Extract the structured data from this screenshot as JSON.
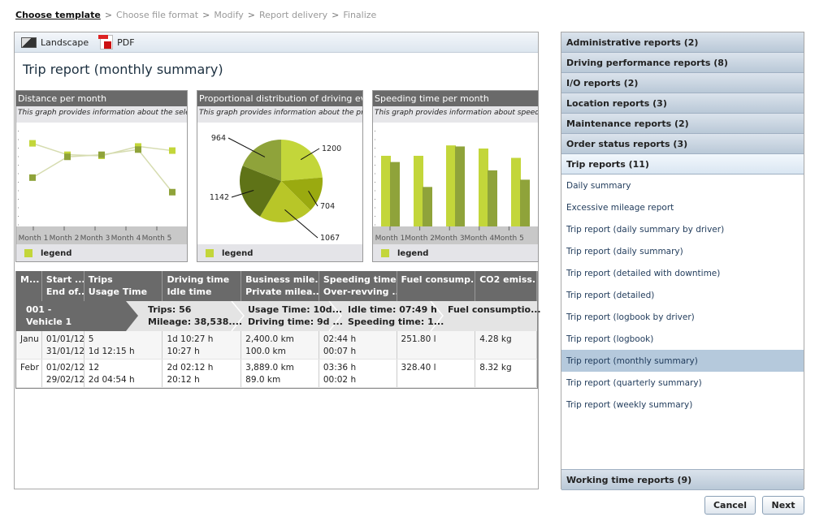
{
  "breadcrumb": {
    "steps": [
      "Choose template",
      "Choose file format",
      "Modify",
      "Report delivery",
      "Finalize"
    ],
    "separator": ">"
  },
  "toolbar": {
    "landscape": "Landscape",
    "pdf": "PDF"
  },
  "report_title": "Trip report (monthly summary)",
  "charts": [
    {
      "title": "Distance per month",
      "subtitle": "This graph provides information about the selected",
      "legend": "legend"
    },
    {
      "title": "Proportional distribution of driving events",
      "subtitle": "This graph provides information about the proportional",
      "legend": "legend"
    },
    {
      "title": "Speeding time per month",
      "subtitle": "This graph provides information about speeding time",
      "legend": "legend"
    }
  ],
  "chart_data": [
    {
      "type": "line",
      "categories": [
        "Month 1",
        "Month 2",
        "Month 3",
        "Month 4",
        "Month 5"
      ],
      "ylim": [
        0,
        10
      ],
      "series": [
        {
          "values": [
            8.0,
            6.9,
            6.8,
            7.7,
            7.3
          ],
          "color": "#c3d63a"
        },
        {
          "values": [
            4.7,
            6.7,
            6.9,
            7.4,
            3.3
          ],
          "color": "#8fa33a"
        }
      ]
    },
    {
      "type": "pie",
      "values": [
        1200,
        704,
        1067,
        1142,
        964
      ],
      "colors": [
        "#c3d63a",
        "#9aaa10",
        "#b8c628",
        "#5f7317",
        "#8fa33a"
      ]
    },
    {
      "type": "bar",
      "categories": [
        "Month 1",
        "Month 2",
        "Month 3",
        "Month 4",
        "Month 5"
      ],
      "ylim": [
        0,
        10
      ],
      "series": [
        {
          "values": [
            6.8,
            6.8,
            7.8,
            7.5,
            6.6
          ],
          "color": "#c3d63a"
        },
        {
          "values": [
            6.2,
            3.8,
            7.7,
            5.4,
            4.5
          ],
          "color": "#8fa33a"
        }
      ]
    }
  ],
  "table": {
    "headers": [
      [
        "M...",
        ""
      ],
      [
        "Start ...",
        "End of..."
      ],
      [
        "Trips",
        "Usage Time"
      ],
      [
        "Driving time",
        "Idle time"
      ],
      [
        "Business mile...",
        "Private milea..."
      ],
      [
        "Speeding time",
        "Over-revving ..."
      ],
      [
        "Fuel consump...",
        ""
      ],
      [
        "CO2 emiss...",
        ""
      ]
    ],
    "group": {
      "vehicle": [
        "001 -",
        "Vehicle 1"
      ],
      "cells": [
        [
          "Trips: 56",
          "Mileage: 38,538...."
        ],
        [
          "Usage Time: 10d...",
          "Driving time: 9d ..."
        ],
        [
          "Idle time: 07:49 h",
          "Speeding time: 1..."
        ],
        [
          "Fuel consumptio...",
          ""
        ]
      ]
    },
    "rows": [
      [
        [
          "Janu",
          ""
        ],
        [
          "01/01/12",
          "31/01/12"
        ],
        [
          "5",
          "1d 12:15 h"
        ],
        [
          "1d 10:27 h",
          "10:27 h"
        ],
        [
          "2,400.0 km",
          "100.0 km"
        ],
        [
          "02:44 h",
          "00:07 h"
        ],
        [
          "251.80 l",
          ""
        ],
        [
          "4.28 kg",
          ""
        ]
      ],
      [
        [
          "Febr",
          ""
        ],
        [
          "01/02/12",
          "29/02/12"
        ],
        [
          "12",
          "2d 04:54 h"
        ],
        [
          "2d 02:12 h",
          "20:12 h"
        ],
        [
          "3,889.0 km",
          "89.0 km"
        ],
        [
          "03:36 h",
          "00:02 h"
        ],
        [
          "328.40 l",
          ""
        ],
        [
          "8.32 kg",
          ""
        ]
      ]
    ]
  },
  "categories": [
    "Administrative reports (2)",
    "Driving performance reports (8)",
    "I/O reports (2)",
    "Location reports (3)",
    "Maintenance reports (2)",
    "Order status reports (3)",
    "Trip reports (11)"
  ],
  "trip_reports": [
    "Daily summary",
    "Excessive mileage report",
    "Trip report (daily summary by driver)",
    "Trip report (daily summary)",
    "Trip report (detailed with downtime)",
    "Trip report (detailed)",
    "Trip report (logbook by driver)",
    "Trip report (logbook)",
    "Trip report (monthly summary)",
    "Trip report (quarterly summary)",
    "Trip report (weekly summary)"
  ],
  "selected_report": "Trip report (monthly summary)",
  "last_category": "Working time reports (9)",
  "buttons": {
    "cancel": "Cancel",
    "next": "Next"
  }
}
